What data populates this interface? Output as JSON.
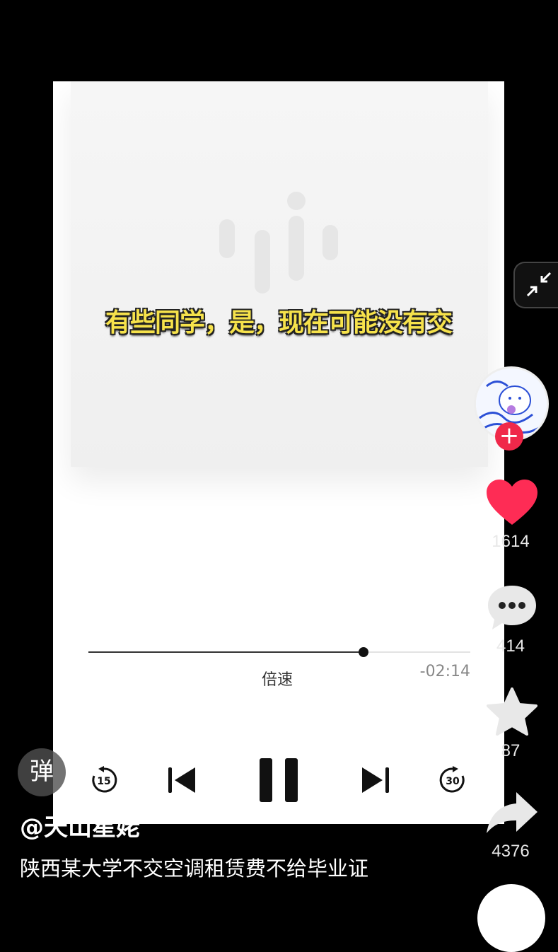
{
  "player": {
    "subtitle": "有些同学，是，现在可能没有交",
    "progress_fraction": 0.72,
    "speed_label": "倍速",
    "remaining_time": "-02:14",
    "skip_back_seconds": "15",
    "skip_forward_seconds": "30"
  },
  "sidebar": {
    "like_count": "1614",
    "comment_count": "414",
    "favorite_count": "87",
    "share_count": "4376"
  },
  "overlay": {
    "danmu_label": "弹",
    "author": "@天山星姥",
    "caption": "陕西某大学不交空调租赁费不给毕业证"
  },
  "colors": {
    "like": "#fe2c55",
    "follow": "#f0284a",
    "subtitle": "#f6e24b"
  },
  "icons": [
    "minimize-icon",
    "heart-icon",
    "comment-icon",
    "star-icon",
    "share-icon",
    "rewind-15-icon",
    "previous-icon",
    "pause-icon",
    "next-icon",
    "forward-30-icon"
  ]
}
